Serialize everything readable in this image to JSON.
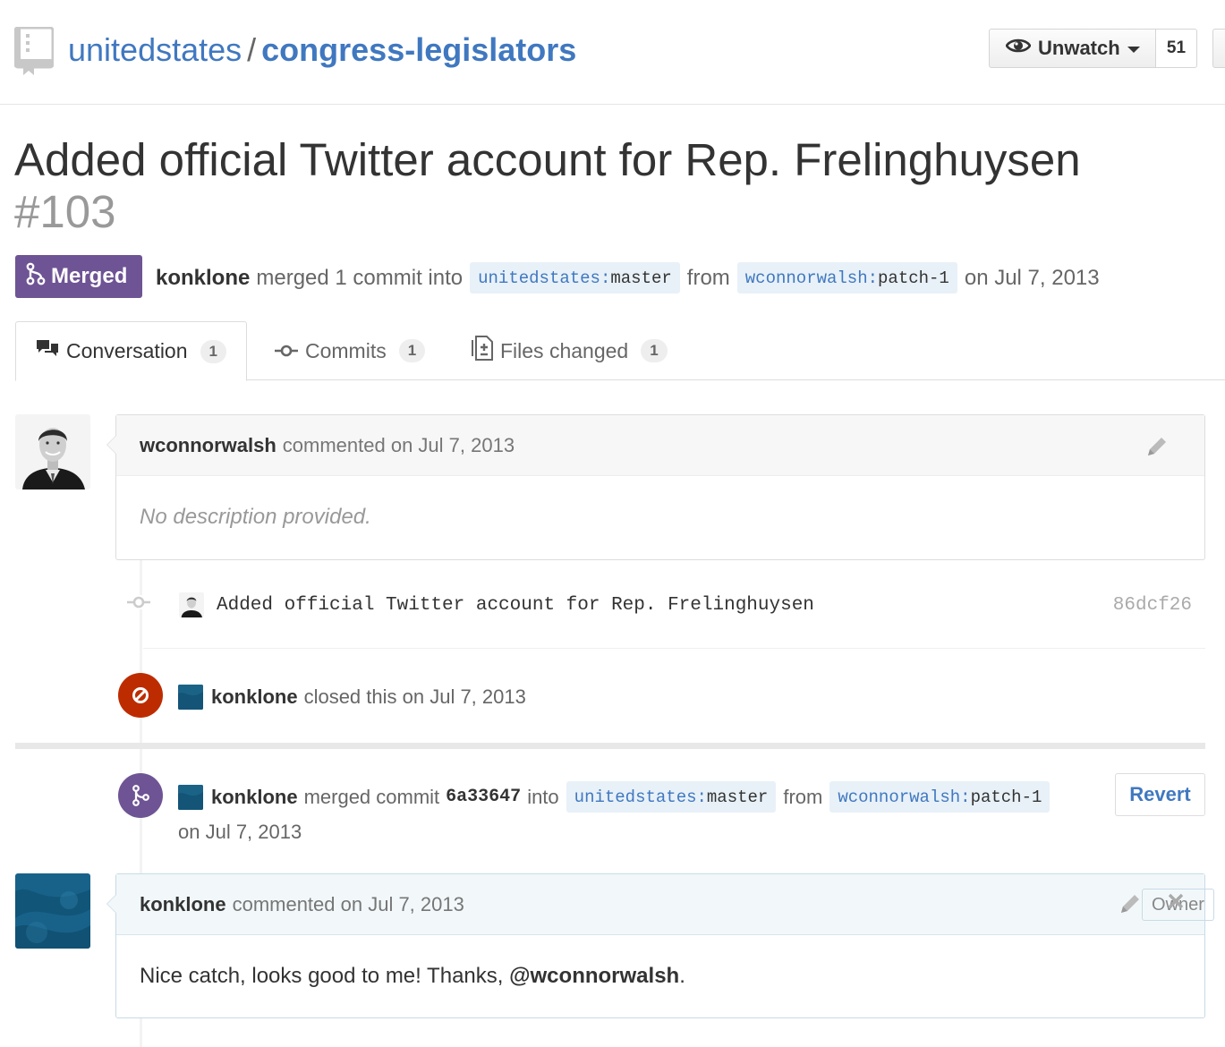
{
  "repo": {
    "owner": "unitedstates",
    "separator": "/",
    "name": "congress-legislators"
  },
  "watch": {
    "label": "Unwatch",
    "count": "51"
  },
  "pull_request": {
    "title": "Added official Twitter account for Rep. Frelinghuysen",
    "number": "#103",
    "state": "Merged",
    "meta": {
      "author": "konklone",
      "action": "merged 1 commit into",
      "base_user": "unitedstates",
      "base_ref": "master",
      "from": "from",
      "head_user": "wconnorwalsh",
      "head_ref": "patch-1",
      "date": "on Jul 7, 2013"
    }
  },
  "tabs": [
    {
      "label": "Conversation",
      "count": "1"
    },
    {
      "label": "Commits",
      "count": "1"
    },
    {
      "label": "Files changed",
      "count": "1"
    }
  ],
  "timeline": {
    "first_comment": {
      "author": "wconnorwalsh",
      "action": "commented on Jul 7, 2013",
      "body": "No description provided."
    },
    "commit": {
      "message": "Added official Twitter account for Rep. Frelinghuysen",
      "sha": "86dcf26"
    },
    "closed_event": {
      "author": "konklone",
      "text": "closed this on Jul 7, 2013"
    },
    "merged_event": {
      "author": "konklone",
      "action": "merged commit",
      "sha": "6a33647",
      "into": "into",
      "base_user": "unitedstates",
      "base_ref": "master",
      "from": "from",
      "head_user": "wconnorwalsh",
      "head_ref": "patch-1",
      "date": "on Jul 7, 2013",
      "revert_label": "Revert"
    },
    "second_comment": {
      "author": "konklone",
      "action": "commented on Jul 7, 2013",
      "owner_label": "Owner",
      "body_prefix": "Nice catch, looks good to me! Thanks, ",
      "mention": "@wconnorwalsh",
      "body_suffix": "."
    }
  },
  "colors": {
    "link": "#4078c0",
    "merged": "#6e5494",
    "closed": "#bd2c00",
    "branch_bg": "#e8f1f8"
  },
  "icons": [
    "repo-icon",
    "eye-icon",
    "caret-down-icon",
    "git-merge-icon",
    "comment-discussion-icon",
    "git-commit-icon",
    "diff-icon",
    "pencil-icon",
    "circle-slash-icon",
    "close-icon"
  ]
}
